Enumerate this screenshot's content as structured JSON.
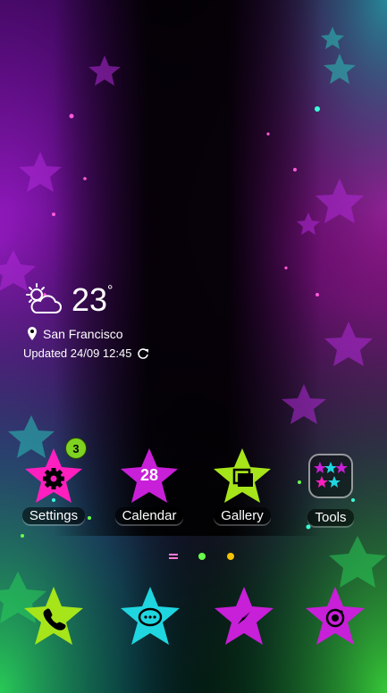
{
  "weather": {
    "temperature": "23",
    "unit": "°",
    "location": "San Francisco",
    "updated": "Updated 24/09 12:45",
    "icon": "partly-cloudy-icon"
  },
  "apps": [
    {
      "label": "Settings",
      "badge": "3",
      "icon": "gear-icon",
      "color": "#ff1fbf"
    },
    {
      "label": "Calendar",
      "date": "28",
      "icon": "calendar-icon",
      "color": "#c81fd8"
    },
    {
      "label": "Gallery",
      "icon": "gallery-icon",
      "color": "#a6e51a"
    },
    {
      "label": "Tools",
      "icon": "folder-icon"
    }
  ],
  "dock": [
    {
      "icon": "phone-icon",
      "color": "#a6e51a"
    },
    {
      "icon": "messages-icon",
      "color": "#1fd6e0"
    },
    {
      "icon": "browser-icon",
      "color": "#c81fd8"
    },
    {
      "icon": "camera-icon",
      "color": "#c81fd8"
    }
  ],
  "page_indicator": {
    "pages": 3,
    "current": 2
  }
}
